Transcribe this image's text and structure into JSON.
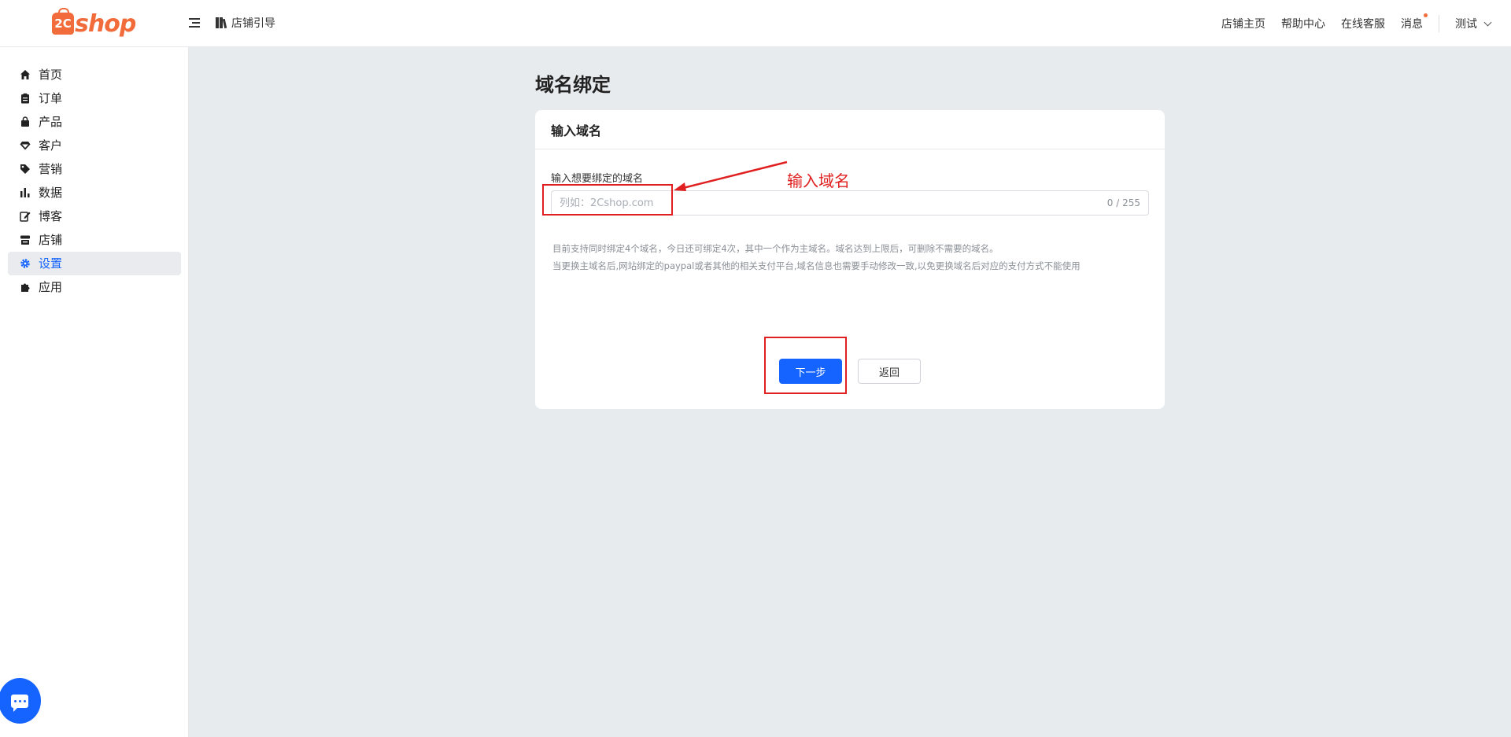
{
  "header": {
    "logo_badge": "2C",
    "logo_text": "shop",
    "guide_label": "店铺引导",
    "links": [
      "店铺主页",
      "帮助中心",
      "在线客服",
      "消息"
    ],
    "user_name": "测试",
    "accent": "#f26b3a"
  },
  "sidebar": {
    "items": [
      {
        "label": "首页",
        "icon": "home-icon"
      },
      {
        "label": "订单",
        "icon": "clipboard-icon"
      },
      {
        "label": "产品",
        "icon": "bag-icon"
      },
      {
        "label": "客户",
        "icon": "gem-icon"
      },
      {
        "label": "营销",
        "icon": "tag-icon"
      },
      {
        "label": "数据",
        "icon": "bar-chart-icon"
      },
      {
        "label": "博客",
        "icon": "edit-icon"
      },
      {
        "label": "店铺",
        "icon": "store-icon"
      },
      {
        "label": "设置",
        "icon": "gear-icon",
        "active": true
      },
      {
        "label": "应用",
        "icon": "puzzle-icon"
      }
    ]
  },
  "main": {
    "title": "域名绑定",
    "card_title": "输入域名",
    "field_label": "输入想要绑定的域名",
    "input_placeholder": "列如：2Cshop.com",
    "input_value": "",
    "counter": "0 / 255",
    "tips": [
      "目前支持同时绑定4个域名，今日还可绑定4次，其中一个作为主域名。域名达到上限后，可删除不需要的域名。",
      "当更换主域名后,网站绑定的paypal或者其他的相关支付平台,域名信息也需要手动修改一致,以免更换域名后对应的支付方式不能使用"
    ],
    "next_button": "下一步",
    "back_button": "返回",
    "primary_color": "#1664ff"
  },
  "annotation": {
    "text": "输入域名",
    "color": "#e02020"
  }
}
